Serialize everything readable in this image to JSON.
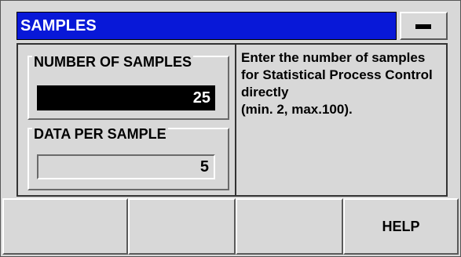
{
  "window": {
    "title": "SAMPLES",
    "minimize_icon": "dash-icon"
  },
  "form": {
    "number_of_samples": {
      "label": "NUMBER OF SAMPLES",
      "value": "25",
      "active": true
    },
    "data_per_sample": {
      "label": "DATA PER SAMPLE",
      "value": "5",
      "active": false
    }
  },
  "help": {
    "lines": [
      "Enter the number of samples",
      "for Statistical Process Control",
      "directly",
      "(min. 2, max.100)."
    ]
  },
  "softkeys": [
    {
      "label": ""
    },
    {
      "label": ""
    },
    {
      "label": ""
    },
    {
      "label": "HELP"
    }
  ],
  "colors": {
    "title_bar": "#0818d8",
    "background": "#d8d8d8",
    "active_field": "#000000"
  }
}
